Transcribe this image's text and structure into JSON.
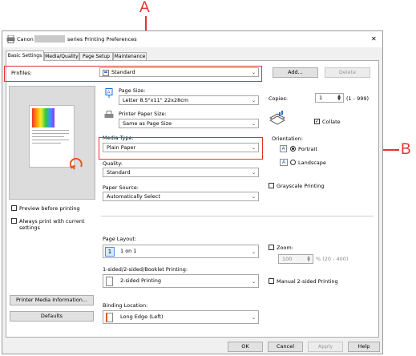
{
  "callouts": {
    "a": "A",
    "b": "B"
  },
  "window": {
    "title_prefix": "Canon",
    "title_suffix": "series Printing Preferences",
    "close_label": "✕"
  },
  "tabs": [
    {
      "label": "Basic Settings",
      "active": true
    },
    {
      "label": "Media/Quality"
    },
    {
      "label": "Page Setup"
    },
    {
      "label": "Maintenance"
    }
  ],
  "profiles": {
    "label": "Profiles:",
    "value": "Standard",
    "add_label": "Add...",
    "delete_label": "Delete"
  },
  "left": {
    "preview_label": "Preview before printing",
    "always_label": "Always print with current settings",
    "media_info_label": "Printer Media Information...",
    "defaults_label": "Defaults"
  },
  "page_size": {
    "label": "Page Size:",
    "value": "Letter 8.5\"x11\" 22x28cm"
  },
  "printer_paper_size": {
    "label": "Printer Paper Size:",
    "value": "Same as Page Size"
  },
  "media_type": {
    "label": "Media Type:",
    "value": "Plain Paper"
  },
  "quality": {
    "label": "Quality:",
    "value": "Standard"
  },
  "paper_source": {
    "label": "Paper Source:",
    "value": "Automatically Select"
  },
  "copies": {
    "label": "Copies:",
    "value": "1",
    "range": "(1 - 999)",
    "collate_label": "Collate",
    "collate_checked": true
  },
  "orientation": {
    "label": "Orientation:",
    "portrait_label": "Portrait",
    "landscape_label": "Landscape",
    "selected": "Portrait"
  },
  "grayscale": {
    "label": "Grayscale Printing",
    "checked": false
  },
  "page_layout": {
    "label": "Page Layout:",
    "value": "1 on 1",
    "icon_text": "1"
  },
  "zoom": {
    "label": "Zoom:",
    "value": "100",
    "range": "% (20 - 400)",
    "checked": false
  },
  "duplex": {
    "label": "1-sided/2-sided/Booklet Printing:",
    "value": "2-sided Printing"
  },
  "manual_duplex": {
    "label": "Manual 2-sided Printing",
    "checked": false
  },
  "binding": {
    "label": "Binding Location:",
    "value": "Long Edge (Left)"
  },
  "footer": {
    "ok": "OK",
    "cancel": "Cancel",
    "apply": "Apply",
    "help": "Help"
  },
  "colors": {
    "annotation_red": "#e8312f",
    "selection_red": "#e23a2a",
    "accent_blue": "#1a6fd0"
  }
}
